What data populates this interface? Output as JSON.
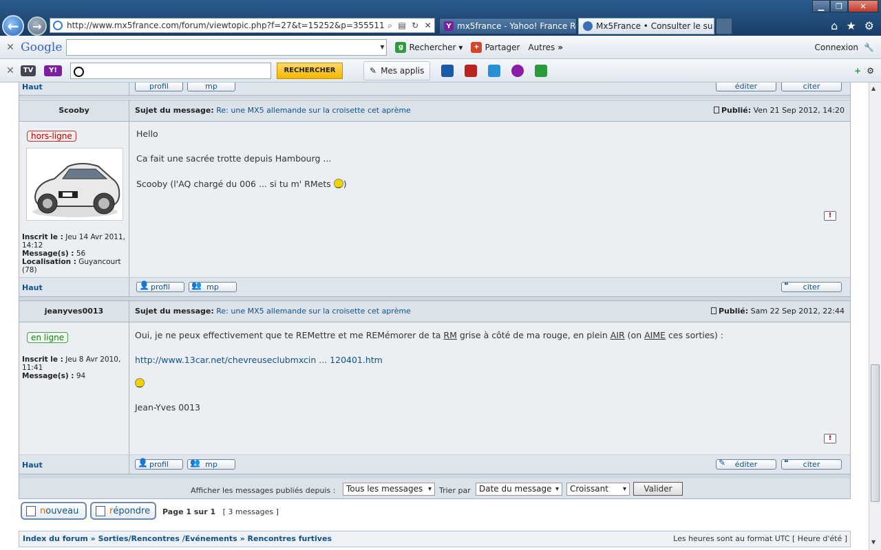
{
  "browser": {
    "url": "http://www.mx5france.com/forum/viewtopic.php?f=27&t=15252&p=355511#p35551",
    "tabs": [
      {
        "label": "mx5france - Yahoo! France Rés..."
      },
      {
        "label": "Mx5France • Consulter le su..."
      }
    ],
    "google_toolbar": {
      "logo": "Google",
      "search": "Rechercher",
      "share": "Partager",
      "more": "Autres",
      "login": "Connexion"
    },
    "yahoo_toolbar": {
      "search_btn": "RECHERCHER",
      "apps": "Mes applis"
    }
  },
  "posts": [
    {
      "author": "Scooby",
      "status": "hors-ligne",
      "subject_label": "Sujet du message:",
      "subject": "Re: une MX5 allemande sur la croisette cet aprème",
      "posted_label": "Publié:",
      "posted": "Ven 21 Sep 2012, 14:20",
      "lines": [
        "Hello",
        "Ca fait une sacrée trotte depuis Hambourg ...",
        "Scooby (l'AQ chargé du 006 ... si tu m' RMets"
      ],
      "line_end": ")",
      "info": {
        "inscrit_label": "Inscrit le :",
        "inscrit": "Jeu 14 Avr 2011, 14:12",
        "messages_label": "Message(s) :",
        "messages": "56",
        "loc_label": "Localisation :",
        "loc": "Guyancourt (78)"
      }
    },
    {
      "author": "jeanyves0013",
      "status": "en ligne",
      "subject_label": "Sujet du message:",
      "subject": "Re: une MX5 allemande sur la croisette cet aprème",
      "posted_label": "Publié:",
      "posted": "Sam 22 Sep 2012, 22:44",
      "text_a": "Oui, je ne peux effectivement que te REMettre et me REMémorer de ta ",
      "text_rm": "RM",
      "text_b": " grise à côté de ma rouge, en plein ",
      "text_air": "AIR",
      "text_c": " (on ",
      "text_aime": "AIME",
      "text_d": " ces sorties) :",
      "link": "http://www.13car.net/chevreuseclubmxcin ... 120401.htm",
      "signature": "Jean-Yves 0013",
      "info": {
        "inscrit_label": "Inscrit le :",
        "inscrit": "Jeu 8 Avr 2010, 11:41",
        "messages_label": "Message(s) :",
        "messages": "94"
      }
    }
  ],
  "buttons": {
    "top": "Haut",
    "profile": "profil",
    "pm": "mp",
    "edit": "éditer",
    "quote": "citer",
    "report": "!"
  },
  "sort": {
    "label1": "Afficher les messages publiés depuis :",
    "sel1": "Tous les messages",
    "label2": "Trier par",
    "sel2": "Date du message",
    "sel3": "Croissant",
    "submit": "Valider"
  },
  "actions": {
    "new_o": "n",
    "new_rest": "ouveau",
    "reply_o": "r",
    "reply_rest": "épondre"
  },
  "pagination": {
    "page": "Page 1 sur 1",
    "count": "[ 3 messages ]"
  },
  "breadcrumb": {
    "items": [
      "Index du forum",
      "Sorties/Rencontres /Evénements",
      "Rencontres furtives"
    ],
    "sep": "»",
    "timezone": "Les heures sont au format UTC [ Heure d'été ]"
  }
}
